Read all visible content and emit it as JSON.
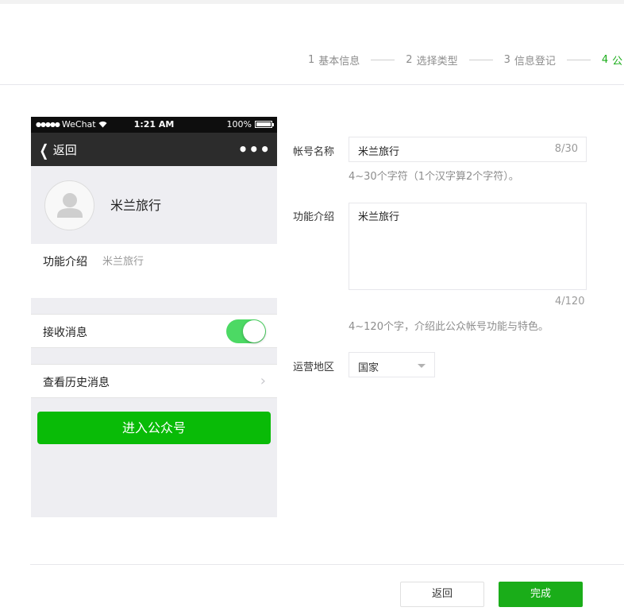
{
  "steps": [
    {
      "num": "1",
      "label": "基本信息"
    },
    {
      "num": "2",
      "label": "选择类型"
    },
    {
      "num": "3",
      "label": "信息登记"
    },
    {
      "num": "4",
      "label": "公"
    }
  ],
  "phone": {
    "status": {
      "carrier": "WeChat",
      "time": "1:21 AM",
      "battery": "100%"
    },
    "nav": {
      "back_label": "返回",
      "more": "•••"
    },
    "profile_name": "米兰旅行",
    "intro_label": "功能介绍",
    "intro_value": "米兰旅行",
    "receive_label": "接收消息",
    "receive_enabled": true,
    "history_label": "查看历史消息",
    "enter_button": "进入公众号"
  },
  "form": {
    "name_label": "帐号名称",
    "name_value": "米兰旅行",
    "name_counter": "8/30",
    "name_hint": "4~30个字符（1个汉字算2个字符）。",
    "intro_label": "功能介绍",
    "intro_value": "米兰旅行",
    "intro_counter": "4/120",
    "intro_hint": "4~120个字，介绍此公众帐号功能与特色。",
    "region_label": "运营地区",
    "region_value": "国家"
  },
  "footer": {
    "back_label": "返回",
    "done_label": "完成"
  },
  "colors": {
    "accent": "#1aad19",
    "enter_button": "#09bb07",
    "toggle_on": "#4cd964"
  }
}
